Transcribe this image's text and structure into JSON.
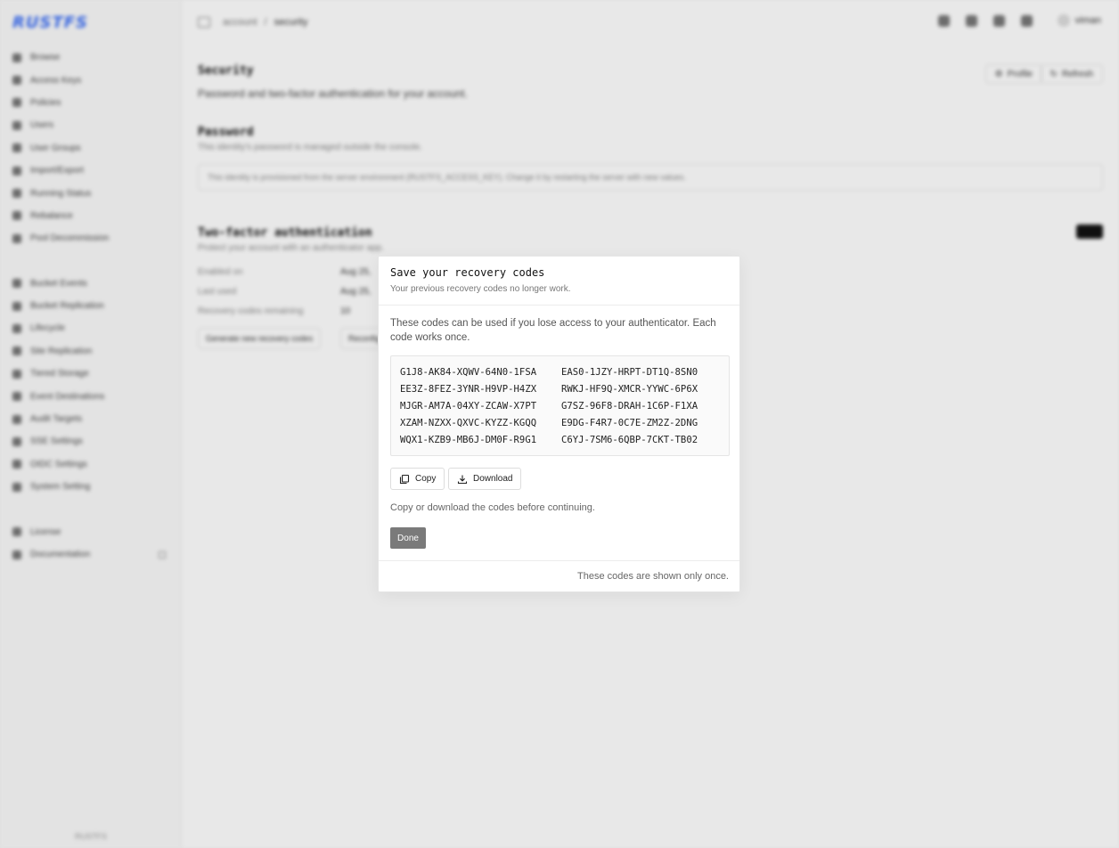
{
  "app": {
    "brand": "RUSTFS",
    "footer": "RUSTFS"
  },
  "sidebar": {
    "group1": [
      {
        "label": "Browse"
      },
      {
        "label": "Access Keys"
      },
      {
        "label": "Policies"
      },
      {
        "label": "Users"
      },
      {
        "label": "User Groups"
      },
      {
        "label": "Import/Export"
      },
      {
        "label": "Running Status"
      },
      {
        "label": "Rebalance"
      },
      {
        "label": "Pool Decommission"
      }
    ],
    "group2": [
      {
        "label": "Bucket Events"
      },
      {
        "label": "Bucket Replication"
      },
      {
        "label": "Lifecycle"
      },
      {
        "label": "Site Replication"
      },
      {
        "label": "Tiered Storage"
      },
      {
        "label": "Event Destinations"
      },
      {
        "label": "Audit Targets"
      },
      {
        "label": "SSE Settings"
      },
      {
        "label": "OIDC Settings"
      },
      {
        "label": "System Setting"
      }
    ],
    "group3": [
      {
        "label": "License"
      },
      {
        "label": "Documentation"
      }
    ]
  },
  "header": {
    "breadcrumb": [
      "account",
      "security"
    ],
    "user": "viman"
  },
  "page": {
    "title": "Security",
    "subtitle": "Password and two-factor authentication for your account.",
    "profile_btn": "Profile",
    "refresh_btn": "Refresh",
    "password_title": "Password",
    "password_sub": "This identity's password is managed outside the console.",
    "password_notice": "This identity is provisioned from the server environment (RUSTFS_ACCESS_KEY). Change it by restarting the server with new values.",
    "tfa_title": "Two-factor authentication",
    "tfa_sub": "Protect your account with an authenticator app.",
    "enabled_on_label": "Enabled on",
    "enabled_on_value": "Aug 25,",
    "last_used_label": "Last used",
    "last_used_value": "Aug 25,",
    "remaining_label": "Recovery codes remaining",
    "remaining_value": "10",
    "gen_btn": "Generate new recovery codes",
    "reconf_btn": "Reconfig"
  },
  "modal": {
    "title": "Save your recovery codes",
    "subtitle": "Your previous recovery codes no longer work.",
    "description": "These codes can be used if you lose access to your authenticator. Each code works once.",
    "codes": [
      "G1J8-AK84-XQWV-64N0-1FSA",
      "EAS0-1JZY-HRPT-DT1Q-8SN0",
      "EE3Z-8FEZ-3YNR-H9VP-H4ZX",
      "RWKJ-HF9Q-XMCR-YYWC-6P6X",
      "MJGR-AM7A-04XY-ZCAW-X7PT",
      "G7SZ-96F8-DRAH-1C6P-F1XA",
      "XZAM-NZXX-QXVC-KYZZ-KGQQ",
      "E9DG-F4R7-0C7E-ZM2Z-2DNG",
      "WQX1-KZB9-MB6J-DM0F-R9G1",
      "C6YJ-7SM6-6QBP-7CKT-TB02"
    ],
    "copy_label": "Copy",
    "download_label": "Download",
    "hint": "Copy or download the codes before continuing.",
    "done_label": "Done",
    "footer": "These codes are shown only once."
  }
}
